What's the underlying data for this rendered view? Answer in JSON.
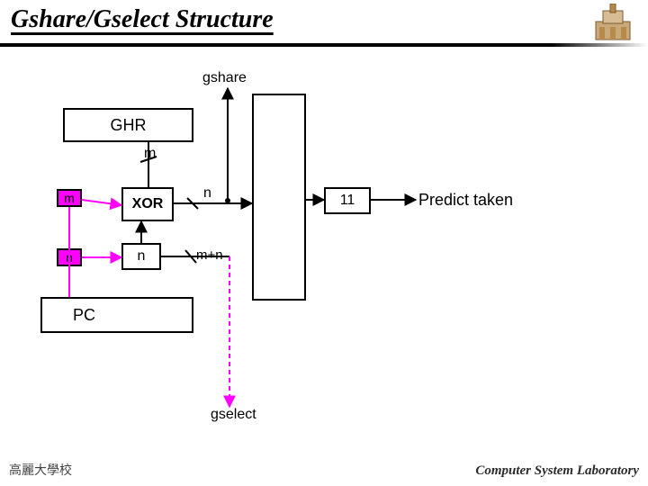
{
  "title": "Gshare/Gselect Structure",
  "diagram": {
    "gshare_label": "gshare",
    "ghr_label": "GHR",
    "pc_label": "PC",
    "xor_label": "XOR",
    "n_box_label": "n",
    "m_tag": "m",
    "n_tag": "n",
    "m_wire_label": "m",
    "n_wire_label": "n",
    "concat_label": "m+n",
    "entry_value": "11",
    "predict_label": "Predict taken",
    "gselect_label": "gselect"
  },
  "footer": {
    "left": "高麗大學校",
    "right": "Computer System Laboratory"
  }
}
